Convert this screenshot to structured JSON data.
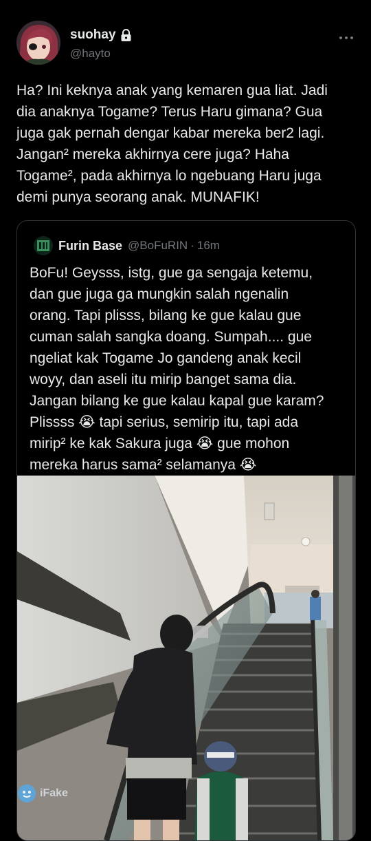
{
  "author": {
    "display_name": "suohay",
    "handle": "@hayto",
    "protected_icon": "lock-icon",
    "more_icon": "more-horizontal-icon"
  },
  "tweet": {
    "text_lines": [
      "Ha? Ini keknya anak yang kemaren gua liat. Jadi",
      "dia anaknya Togame? Terus Haru gimana? Gua",
      "juga gak pernah dengar kabar mereka ber2 lagi.",
      "Jangan² mereka akhirnya cere juga? Haha",
      "Togame², pada akhirnya lo ngebuang Haru juga",
      "demi punya seorang anak. MUNAFIK!"
    ]
  },
  "quoted_tweet": {
    "display_name": "Furin Base",
    "handle": "@BoFuRIN",
    "separator": "·",
    "time": "16m",
    "text_lines": [
      "BoFu! Geysss, istg, gue ga sengaja ketemu,",
      "dan gue juga ga mungkin salah ngenalin",
      "orang. Tapi plisss, bilang ke gue kalau gue",
      "cuman salah sangka doang. Sumpah.... gue",
      "ngeliat kak Togame Jo gandeng anak kecil",
      "woyy, dan aseli itu mirip banget sama dia.",
      "Jangan bilang ke gue kalau kapal gue karam?",
      "Plissss 😭 tapi serius, semirip itu, tapi ada",
      "mirip² ke kak Sakura juga 😭 gue mohon",
      "mereka harus sama² selamanya 😭"
    ],
    "photo_description_icon": "escalator-photo"
  },
  "watermark": {
    "text": "iFake",
    "icon": "ifake-logo-icon"
  },
  "colors": {
    "background": "#000000",
    "text": "#e7e9ea",
    "secondary": "#71767b",
    "border": "#2f3336"
  }
}
